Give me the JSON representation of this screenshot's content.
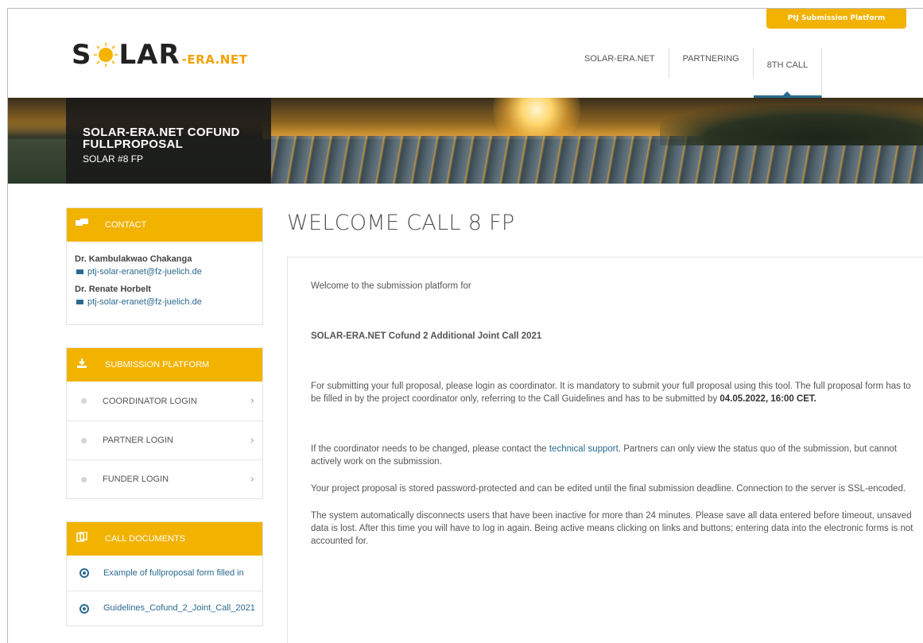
{
  "header": {
    "ptj_tab": "PtJ Submission Platform",
    "logo": {
      "text_s": "S",
      "text_lar": "LAR",
      "text_eranet": "-ERA.NET"
    },
    "nav": [
      "SOLAR-ERA.NET",
      "PARTNERING",
      "8TH CALL"
    ],
    "active_nav": "8TH CALL"
  },
  "hero": {
    "title": "SOLAR-ERA.NET COFUND FULLPROPOSAL",
    "subtitle": "SOLAR #8 FP"
  },
  "sidebar": {
    "contact": {
      "heading": "CONTACT",
      "people": [
        {
          "name": "Dr. Kambulakwao Chakanga",
          "email": "ptj-solar-eranet@fz-juelich.de"
        },
        {
          "name": "Dr. Renate Horbelt",
          "email": "ptj-solar-eranet@fz-juelich.de"
        }
      ]
    },
    "submission": {
      "heading": "SUBMISSION PLATFORM",
      "items": [
        "COORDINATOR LOGIN",
        "PARTNER LOGIN",
        "FUNDER LOGIN"
      ]
    },
    "documents": {
      "heading": "CALL DOCUMENTS",
      "items": [
        "Example of fullproposal form filled in",
        "Guidelines_Cofund_2_Joint_Call_2021"
      ]
    }
  },
  "main": {
    "title": "WELCOME CALL 8 FP",
    "intro": "Welcome to the submission platform for",
    "call_name": "SOLAR-ERA.NET Cofund 2 Additional Joint Call 2021",
    "para_submit": "For submitting your full proposal, please login as coordinator. It is mandatory to submit your full proposal using this tool. The full proposal form has to be filled in by the project coordinator only, referring to the Call Guidelines and has to be submitted by",
    "deadline": "04.05.2022, 16:00 CET.",
    "para_coord_a": "If the coordinator needs to be changed, please contact the",
    "support_link": "technical support",
    "para_coord_b": ". Partners can only view the status quo of the submission, but cannot actively work on the submission.",
    "para_password": "Your project proposal is stored password-protected and can be edited until the final submission deadline. Connection to the server is SSL-encoded.",
    "para_timeout": "The system automatically disconnects users that have been inactive for more than 24 minutes. Please save all data entered before timeout, unsaved data is lost. After this time you will have to log in again. Being active means clicking on links and buttons; entering data into the electronic forms is not accounted for."
  },
  "colors": {
    "accent": "#f2b200",
    "link": "#2a6a8f",
    "nav_active": "#2a6a8f"
  },
  "icons": [
    "chat-icon",
    "download-icon",
    "documents-icon",
    "mail-icon",
    "chevron-right-icon",
    "download-circle-icon"
  ]
}
